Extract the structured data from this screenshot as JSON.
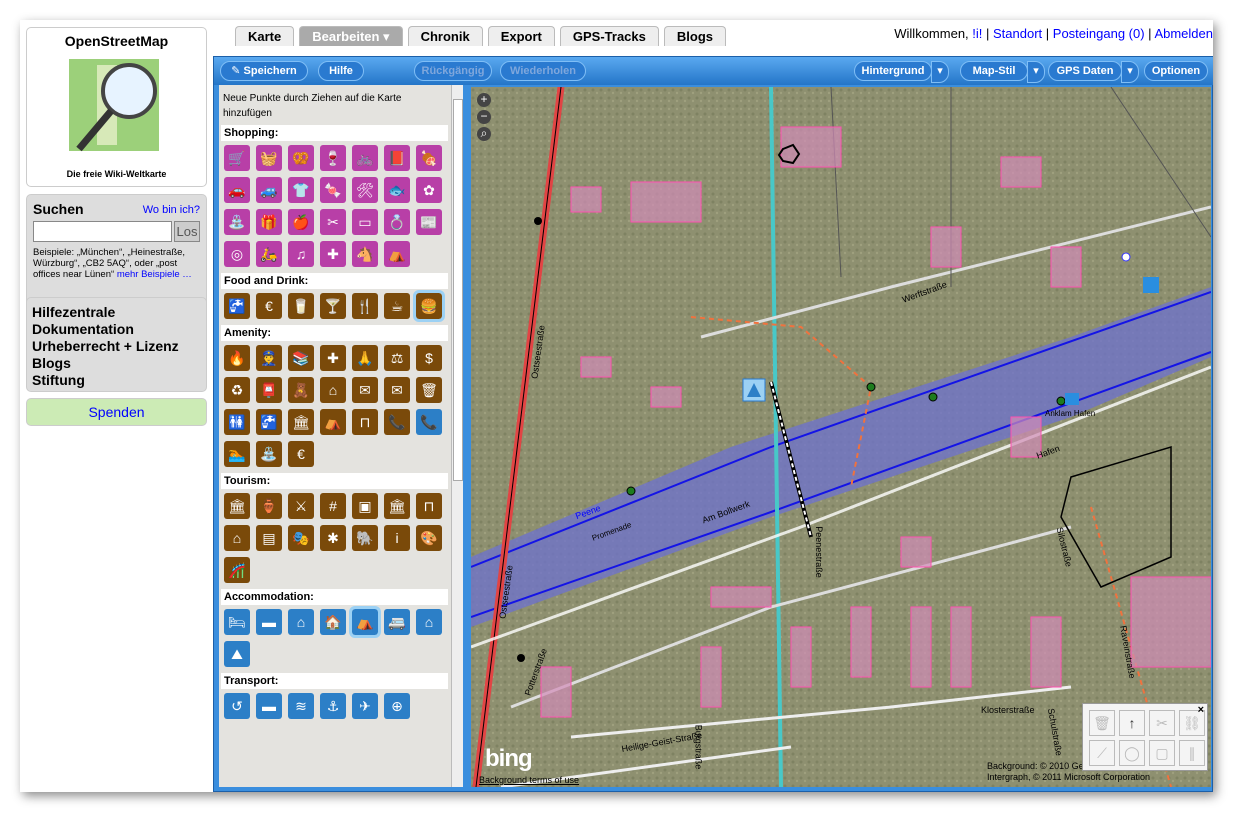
{
  "logo": {
    "title": "OpenStreetMap",
    "subtitle": "Die freie Wiki-Weltkarte"
  },
  "search": {
    "heading": "Suchen",
    "where_link": "Wo bin ich?",
    "value": "",
    "go_label": "Los",
    "examples": "Beispiele: „München“, „Heinestraße, Würzburg“, „CB2 5AQ“, oder „post offices near Lünen“",
    "more_link": "mehr Beispiele …"
  },
  "links": [
    "Hilfezentrale",
    "Dokumentation",
    "Urheberrecht + Lizenz",
    "Blogs",
    "Stiftung"
  ],
  "donate": "Spenden",
  "tabs": [
    "Karte",
    "Bearbeiten ▾",
    "Chronik",
    "Export",
    "GPS-Tracks",
    "Blogs"
  ],
  "user": {
    "welcome": "Willkommen, ",
    "name": "!i!",
    "standort": "Standort",
    "inbox": "Posteingang (0)",
    "logout": "Abmelden"
  },
  "toolbar": {
    "save": "Speichern",
    "help": "Hilfe",
    "undo": "Rückgängig",
    "redo": "Wiederholen",
    "background": "Hintergrund",
    "mapstyle": "Map-Stil",
    "gps": "GPS Daten",
    "options": "Optionen"
  },
  "palette": {
    "hint": "Neue Punkte durch Ziehen auf die Karte hinzufügen",
    "cats": {
      "shopping": "Shopping:",
      "food": "Food and Drink:",
      "amenity": "Amenity:",
      "tourism": "Tourism:",
      "accommodation": "Accommodation:",
      "transport": "Transport:"
    }
  },
  "map": {
    "streets": [
      "Ostseestraße",
      "Werftstraße",
      "Am Bollwerk",
      "Promenade",
      "Peene",
      "Peenestraße",
      "Hafen",
      "Silostraße",
      "Raveinstraße",
      "Klosterstraße",
      "Potterstraße",
      "Heilige-Geist-Straße",
      "Burgstraße",
      "Schulstraße"
    ],
    "poi": "Anklam Hafen",
    "credit": "Background: © 2010 GeoEye, © GeoContent / (p) Intergraph, © 2011 Microsoft Corporation",
    "bing": "bing",
    "terms": "Background terms of use"
  }
}
